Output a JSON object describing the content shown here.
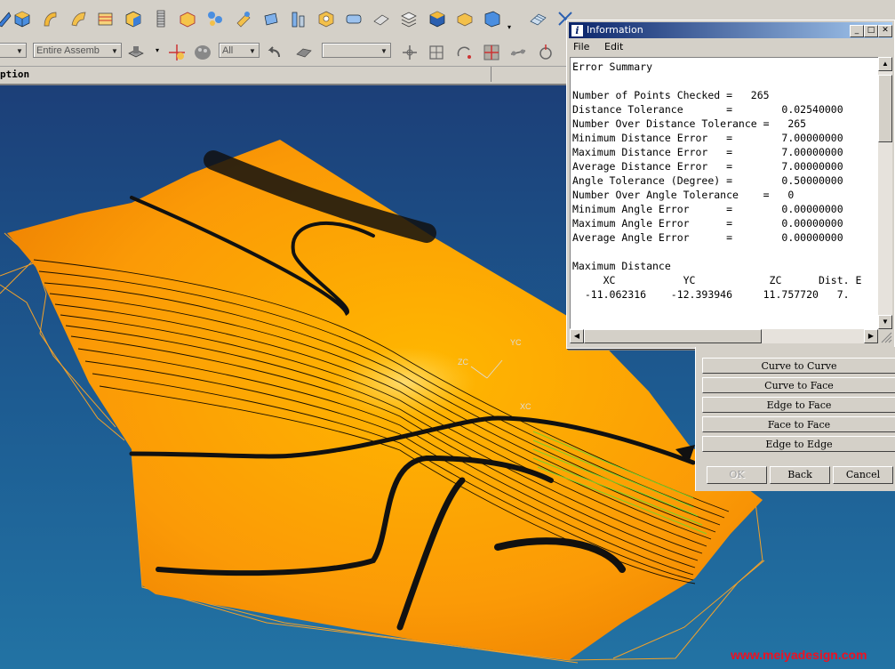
{
  "toolbar": {
    "assembly_filter": "Entire Assemb",
    "type_filter": "All",
    "blank_combo": ""
  },
  "header": {
    "description_col": "ption"
  },
  "info_window": {
    "title": "Information",
    "title_icon": "i",
    "menu": {
      "file": "File",
      "edit": "Edit"
    },
    "content_lines": [
      "Error Summary",
      "",
      "Number of Points Checked =   265",
      "Distance Tolerance       =        0.02540000",
      "Number Over Distance Tolerance =   265",
      "Minimum Distance Error   =        7.00000000",
      "Maximum Distance Error   =        7.00000000",
      "Average Distance Error   =        7.00000000",
      "Angle Tolerance (Degree) =        0.50000000",
      "Number Over Angle Tolerance    =   0",
      "Minimum Angle Error      =        0.00000000",
      "Maximum Angle Error      =        0.00000000",
      "Average Angle Error      =        0.00000000",
      "",
      "Maximum Distance",
      "     XC           YC            ZC      Dist. E",
      "  -11.062316    -12.393946     11.757720   7."
    ]
  },
  "check_panel": {
    "options": [
      "Curve to Curve",
      "Curve to Face",
      "Edge to Face",
      "Face to Face",
      "Edge to Edge"
    ],
    "ok_label": "OK",
    "back_label": "Back",
    "cancel_label": "Cancel"
  },
  "viewport": {
    "axis_labels": {
      "xc": "XC",
      "yc": "YC",
      "zc": "ZC"
    }
  },
  "watermark": "www.meiyadesign.com",
  "colors": {
    "surface": "#f59a08",
    "background": "#1d5c92",
    "titlebar": "#0a246a"
  }
}
